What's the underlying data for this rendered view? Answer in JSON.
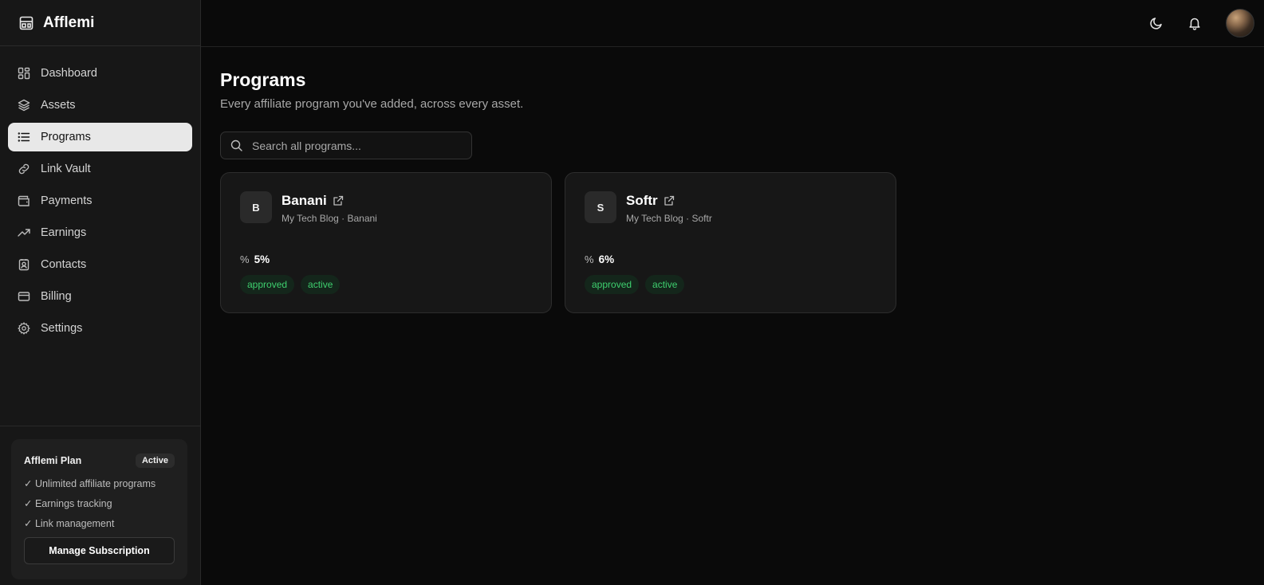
{
  "brand": {
    "name": "Afflemi"
  },
  "sidebar": {
    "items": [
      {
        "label": "Dashboard",
        "icon": "grid-icon"
      },
      {
        "label": "Assets",
        "icon": "layers-icon"
      },
      {
        "label": "Programs",
        "icon": "list-icon",
        "active": true
      },
      {
        "label": "Link Vault",
        "icon": "link-icon"
      },
      {
        "label": "Payments",
        "icon": "wallet-icon"
      },
      {
        "label": "Earnings",
        "icon": "trending-up-icon"
      },
      {
        "label": "Contacts",
        "icon": "contact-icon"
      },
      {
        "label": "Billing",
        "icon": "credit-card-icon"
      },
      {
        "label": "Settings",
        "icon": "gear-icon"
      }
    ]
  },
  "plan": {
    "title": "Afflemi Plan",
    "badge": "Active",
    "features": [
      "✓ Unlimited affiliate programs",
      "✓ Earnings tracking",
      "✓ Link management"
    ],
    "button": "Manage Subscription"
  },
  "page": {
    "title": "Programs",
    "subtitle": "Every affiliate program you've added, across every asset."
  },
  "search": {
    "placeholder": "Search all programs..."
  },
  "programs": [
    {
      "initial": "B",
      "name": "Banani",
      "meta": "My Tech Blog · Banani",
      "commission": "5%",
      "tags": [
        "approved",
        "active"
      ]
    },
    {
      "initial": "S",
      "name": "Softr",
      "meta": "My Tech Blog · Softr",
      "commission": "6%",
      "tags": [
        "approved",
        "active"
      ]
    }
  ],
  "colors": {
    "active_nav_bg": "#e8e8e8",
    "tag_text": "#3ecf6e",
    "tag_bg": "#14261b"
  }
}
